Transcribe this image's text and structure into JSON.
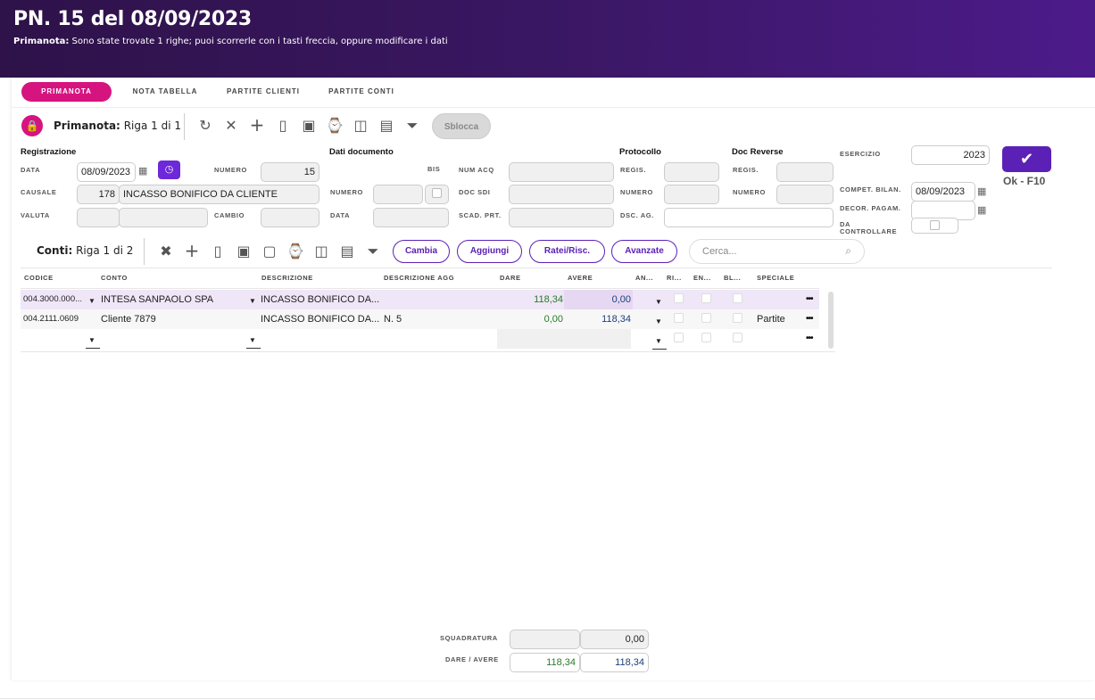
{
  "header": {
    "title": "PN. 15 del 08/09/2023",
    "sub_bold": "Primanota:",
    "sub_text": " Sono state trovate 1 righe; puoi scorrerle con i tasti freccia, oppure modificare i dati"
  },
  "tabs": [
    "PRIMANOTA",
    "NOTA TABELLA",
    "PARTITE CLIENTI",
    "PARTITE CONTI"
  ],
  "toolbar": {
    "label": "Primanota:",
    "riga": "Riga 1 di 1",
    "sblocca": "Sblocca",
    "icons": [
      "refresh-icon",
      "close-icon",
      "add-icon",
      "clipboard-icon",
      "save-icon",
      "watch-icon",
      "book-icon",
      "layout-icon",
      "filter-icon"
    ]
  },
  "form": {
    "registrazione": {
      "title": "Registrazione",
      "data_label": "DATA",
      "data_value": "08/09/2023",
      "numero_label": "NUMERO",
      "numero_value": "15",
      "causale_label": "CAUSALE",
      "causale_code": "178",
      "causale_desc": "INCASSO BONIFICO DA CLIENTE",
      "valuta_label": "VALUTA",
      "cambio_label": "CAMBIO"
    },
    "documento": {
      "title": "Dati documento",
      "bis_label": "BIS",
      "num_acq_label": "NUM ACQ",
      "numero_label": "NUMERO",
      "doc_sdi_label": "DOC SDI",
      "data_label": "DATA",
      "scad_prt_label": "SCAD. PRT."
    },
    "protocollo": {
      "title": "Protocollo",
      "regis_label": "REGIS.",
      "numero_label": "NUMERO",
      "dsc_ag_label": "DSC. AG."
    },
    "doc_reverse": {
      "title": "Doc Reverse",
      "regis_label": "REGIS.",
      "numero_label": "NUMERO"
    },
    "esercizio": {
      "label": "ESERCIZIO",
      "value": "2023",
      "compet_label": "COMPET. BILAN.",
      "compet_value": "08/09/2023",
      "decor_label": "DECOR. PAGAM.",
      "da_controllare_label": "DA CONTROLLARE"
    },
    "ok_label": "Ok - F10"
  },
  "conti": {
    "label": "Conti:",
    "riga": "Riga 1 di 2",
    "buttons": [
      "Cambia",
      "Aggiungi",
      "Ratei/Risc.",
      "Avanzate"
    ],
    "search_placeholder": "Cerca...",
    "columns": [
      "CODICE",
      "CONTO",
      "DESCRIZIONE",
      "DESCRIZIONE AGG",
      "DARE",
      "AVERE",
      "AN...",
      "RI...",
      "EN...",
      "BL...",
      "SPECIALE"
    ],
    "rows": [
      {
        "codice": "004.3000.000...",
        "conto": "INTESA SANPAOLO SPA",
        "descrizione": "INCASSO BONIFICO DA...",
        "descrizione_agg": "",
        "dare": "118,34",
        "avere": "0,00",
        "speciale": ""
      },
      {
        "codice": "004.2111.0609",
        "conto": "Cliente 7879",
        "descrizione": "INCASSO BONIFICO DA...",
        "descrizione_agg": "N. 5",
        "dare": "0,00",
        "avere": "118,34",
        "speciale": "Partite"
      }
    ]
  },
  "totals": {
    "squadratura_label": "SQUADRATURA",
    "squadratura_value": "0,00",
    "dare_avere_label": "DARE / AVERE",
    "dare_total": "118,34",
    "avere_total": "118,34"
  },
  "colors": {
    "header_bg": "#3a1763",
    "accent_pink": "#d6147f",
    "accent_purple": "#5b21b6",
    "selected_row": "#efe6f7",
    "green_value": "#2a7a2a"
  }
}
